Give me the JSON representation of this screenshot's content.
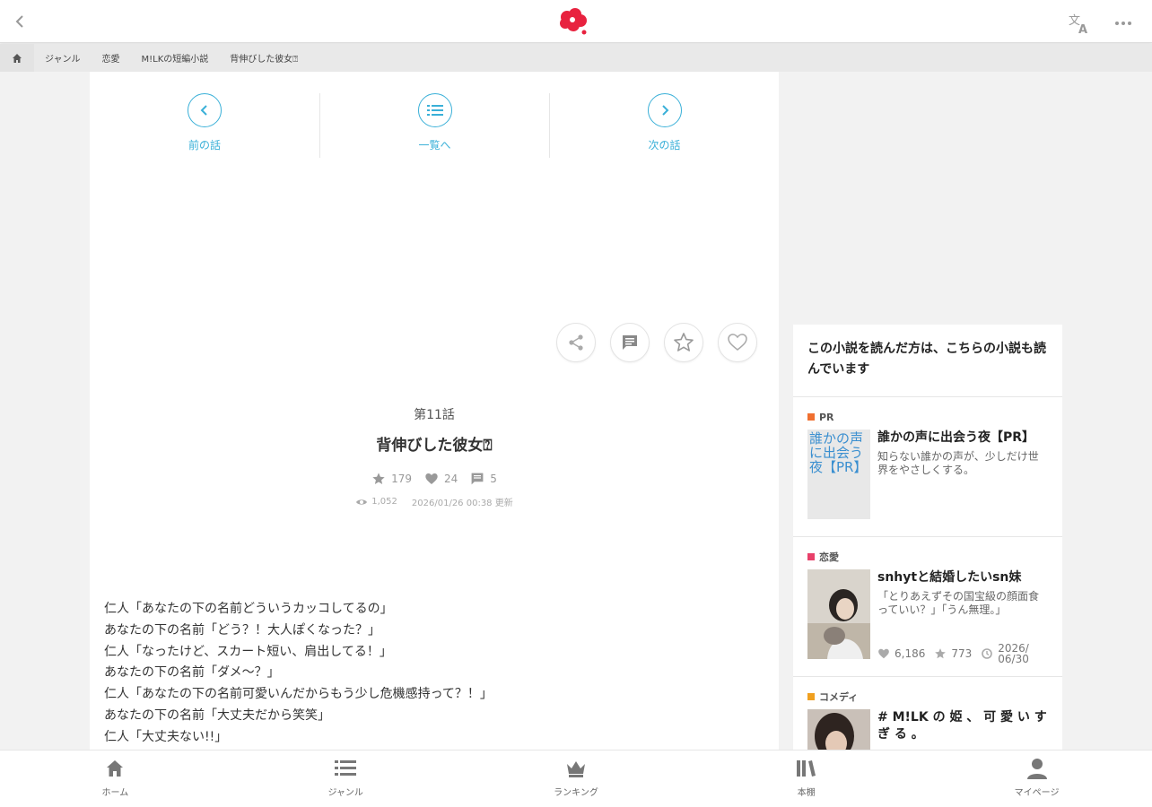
{
  "header": {
    "back_icon": "chevron-left-icon",
    "logo_icon": "brand-flower-logo",
    "translate_icon": "translate-icon",
    "more_icon": "more-horizontal-icon",
    "brand_color": "#e8223f"
  },
  "breadcrumb": {
    "home_icon": "home-icon",
    "items": [
      "ジャンル",
      "恋愛",
      "M!LKの短編小説",
      "背伸びした彼女⍰"
    ]
  },
  "episode_nav": {
    "prev_label": "前の話",
    "list_label": "一覧へ",
    "next_label": "次の話",
    "accent": "#3ab0d8"
  },
  "actions": [
    "share-icon",
    "comment-icon",
    "star-icon",
    "heart-icon"
  ],
  "episode": {
    "number": "第11話",
    "title": "背伸びした彼女⍰",
    "stars": "179",
    "hearts": "24",
    "comments": "5",
    "views": "1,052",
    "updated": "2026/01/26 00:38 更新"
  },
  "story_lines": [
    "仁人「あなたの下の名前どういうカッコしてるの」",
    "あなたの下の名前「どう？！大人ぽくなった？」",
    "仁人「なったけど、スカート短い、肩出してる！」",
    "あなたの下の名前「ダメ〜？」",
    "仁人「あなたの下の名前可愛いんだからもう少し危機感持って？！」",
    "あなたの下の名前「大丈夫だから笑笑」",
    "仁人「大丈夫ない!!」"
  ],
  "sidebar": {
    "heading": "この小説を読んだ方は、こちらの小説も読んでいます",
    "items": [
      {
        "genre": "PR",
        "genre_color": "#f07030",
        "title": "誰かの声に出会う夜【PR】",
        "desc": "知らない誰かの声が、少しだけ世界をやさしくする。",
        "thumb_alt": "誰かの声に出会う夜【PR】"
      },
      {
        "genre": "恋愛",
        "genre_color": "#e8406a",
        "title": "snhytと結婚したいsn妹",
        "desc": "「とりあえずその国宝級の顔面食っていい？」「うん無理。」",
        "hearts": "6,186",
        "stars": "773",
        "updated": "2026/06/30"
      },
      {
        "genre": "コメディ",
        "genre_color": "#f0a020",
        "title": "# M!LK の 姫 、 可 愛 い す ぎ る 。"
      }
    ]
  },
  "bottom_nav": [
    {
      "label": "ホーム",
      "icon": "home-icon"
    },
    {
      "label": "ジャンル",
      "icon": "list-icon"
    },
    {
      "label": "ランキング",
      "icon": "crown-icon"
    },
    {
      "label": "本棚",
      "icon": "bookshelf-icon"
    },
    {
      "label": "マイページ",
      "icon": "user-icon"
    }
  ]
}
